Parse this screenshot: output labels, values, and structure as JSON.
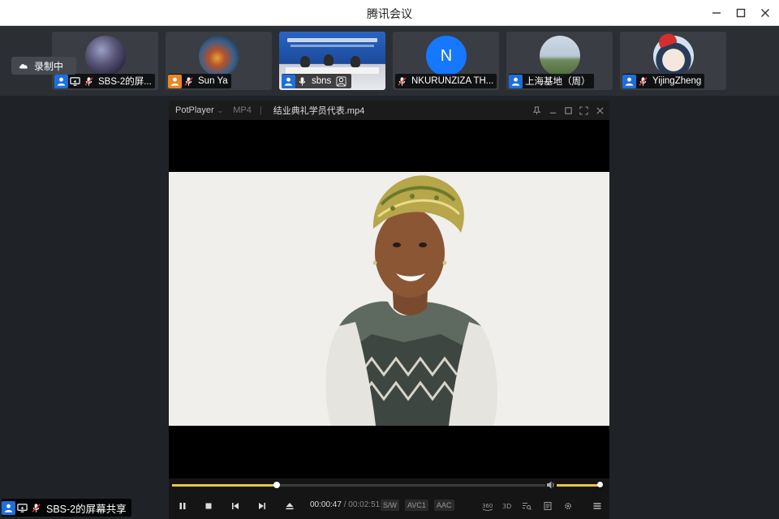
{
  "window": {
    "title": "腾讯会议"
  },
  "recording": {
    "label": "录制中"
  },
  "participants": [
    {
      "name": "SBS-2的屏...",
      "avatar": "galaxy-avatar",
      "icon_color": "#1e6fd9"
    },
    {
      "name": "Sun Ya",
      "avatar": "nebula-avatar",
      "icon_color": "#e8862a"
    },
    {
      "name": "sbns",
      "avatar": "conference-video",
      "icon_color": "#1e6fd9"
    },
    {
      "name": "NKURUNZIZA TH...",
      "avatar_letter": "N",
      "avatar_color": "#1677ff"
    },
    {
      "name": "上海基地（周）",
      "avatar": "landscape-avatar",
      "icon_color": "#1e6fd9"
    },
    {
      "name": "YijingZheng",
      "avatar": "cartoon-avatar",
      "icon_color": "#1e6fd9"
    }
  ],
  "player": {
    "brand": "PotPlayer",
    "format": "MP4",
    "filename": "结业典礼学员代表.mp4",
    "current_time": "00:00:47",
    "total_time": "00:02:51",
    "progress": 0.28,
    "volume": 1.0,
    "tags": [
      "S/W",
      "AVC1",
      "AAC"
    ],
    "accent_color": "#e6c64a"
  },
  "share": {
    "label": "SBS-2的屏幕共享"
  }
}
